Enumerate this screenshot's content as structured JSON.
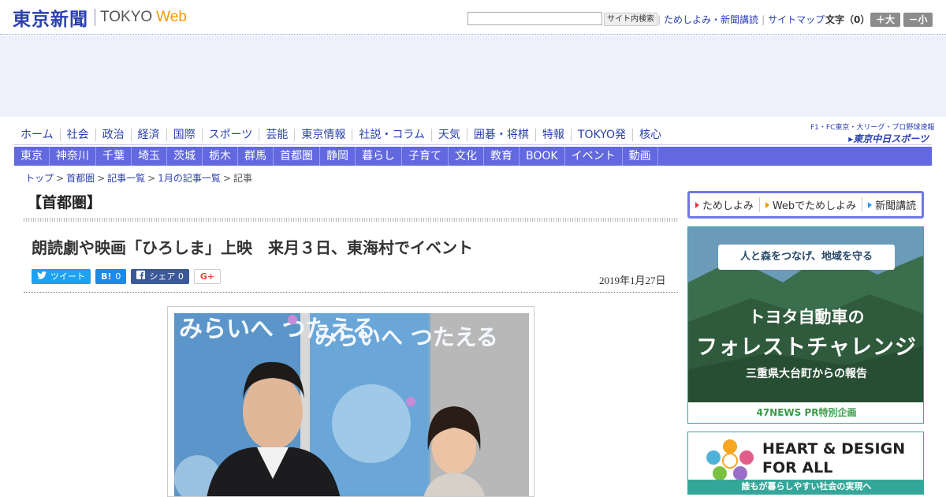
{
  "header": {
    "logo_jp": "東京新聞",
    "logo_en": "TOKYO",
    "logo_web": "Web",
    "search_button": "サイト内検索",
    "links": [
      "ためしよみ・新聞講読",
      "サイトマップ"
    ],
    "font_size_label": "文字（0）",
    "font_large": "＋大",
    "font_small": "－小"
  },
  "main_nav": [
    "ホーム",
    "社会",
    "政治",
    "経済",
    "国際",
    "スポーツ",
    "芸能",
    "東京情報",
    "社説・コラム",
    "天気",
    "囲碁・将棋",
    "特報",
    "TOKYO発",
    "核心"
  ],
  "sports_link": {
    "top": "F1・FC東京・大リーグ・プロ野球速報",
    "bottom": "▸東京中日スポーツ"
  },
  "region_nav": [
    "東京",
    "神奈川",
    "千葉",
    "埼玉",
    "茨城",
    "栃木",
    "群馬",
    "首都圏",
    "静岡",
    "暮らし",
    "子育て",
    "文化",
    "教育",
    "BOOK",
    "イベント",
    "動画"
  ],
  "breadcrumb": [
    "トップ",
    "首都圏",
    "記事一覧",
    "1月の記事一覧",
    "記事"
  ],
  "section_heading": "【首都圏】",
  "article": {
    "title": "朗読劇や映画「ひろしま」上映　来月３日、東海村でイベント",
    "date": "2019年1月27日"
  },
  "share": {
    "tweet": "ツイート",
    "hatena_icon": "B!",
    "hatena_count": "0",
    "facebook_label": "シェア",
    "facebook_count": "0",
    "gplus": "G+"
  },
  "photo": {
    "poster_text": "みらいへ つたえる"
  },
  "sidebar": {
    "tabs": [
      "ためしよみ",
      "Webでためしよみ",
      "新聞講読"
    ],
    "ad1": {
      "ribbon": "人と森をつなげ、地域を守る",
      "line1": "トヨタ自動車の",
      "line2": "フォレストチャレンジ",
      "line3": "三重県大台町からの報告",
      "footer": "47NEWS PR特別企画"
    },
    "ad2": {
      "line1": "HEART & DESIGN",
      "line2": "FOR ALL",
      "footer": "誰もが暮らしやすい社会の実現へ"
    }
  },
  "colors": {
    "brand_blue": "#2b40b0",
    "region_nav_bg": "#6168e0",
    "accent_orange": "#f39800"
  }
}
